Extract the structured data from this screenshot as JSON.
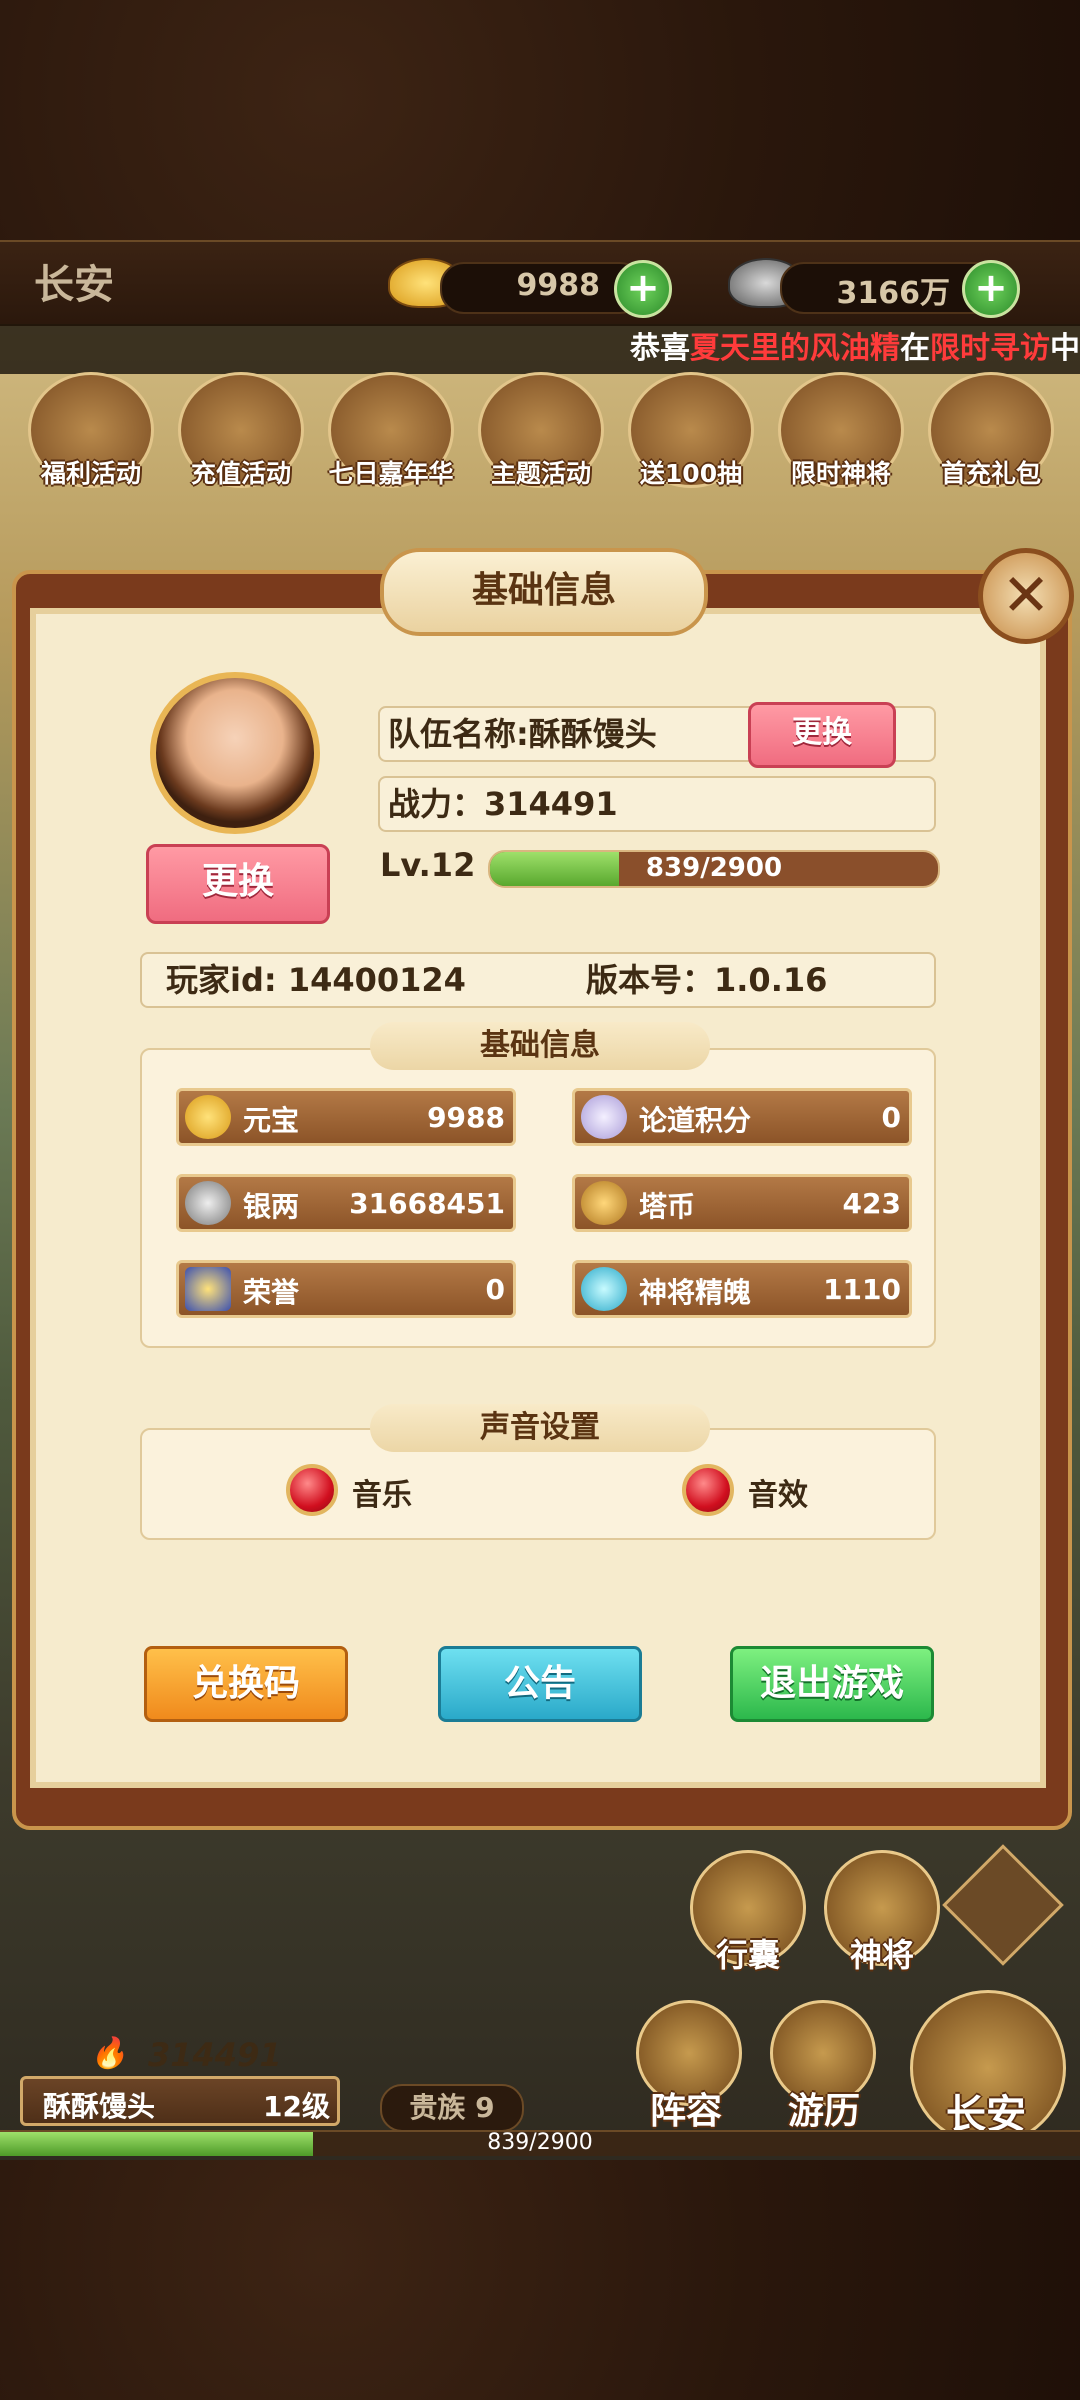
{
  "topbar": {
    "city": "长安",
    "gold": "9988",
    "silver": "3166万"
  },
  "marquee": {
    "p1": "恭喜",
    "p2": "夏天里的风油精",
    "p3": "在",
    "p4": "限时寻访",
    "p5": "中"
  },
  "activities": [
    "福利活动",
    "充值活动",
    "七日嘉年华",
    "主题活动",
    "送100抽",
    "限时神将",
    "首充礼包"
  ],
  "panel": {
    "title": "基础信息",
    "change_avatar": "更换",
    "team_name": "队伍名称:酥酥馒头",
    "change_name": "更换",
    "power": "战力：314491",
    "level": "Lv.12",
    "xp_text": "839/2900",
    "xp_fraction": 0.289,
    "player_id": "玩家id: 14400124",
    "version": "版本号：1.0.16",
    "basic_label": "基础信息",
    "resources": [
      {
        "name": "元宝",
        "value": "9988",
        "icon": "gold-ingot-icon"
      },
      {
        "name": "论道积分",
        "value": "0",
        "icon": "scroll-icon"
      },
      {
        "name": "银两",
        "value": "31668451",
        "icon": "silver-ingot-icon"
      },
      {
        "name": "塔币",
        "value": "423",
        "icon": "coin-icon"
      },
      {
        "name": "荣誉",
        "value": "0",
        "icon": "honor-badge-icon"
      },
      {
        "name": "神将精魄",
        "value": "1110",
        "icon": "spirit-gem-icon"
      }
    ],
    "sound_label": "声音设置",
    "music": "音乐",
    "sfx": "音效",
    "redeem": "兑换码",
    "notice": "公告",
    "exit": "退出游戏"
  },
  "hud": {
    "power": "314491",
    "name": "酥酥馒头",
    "level": "12级",
    "vip": "贵族 9",
    "xp": "839/2900",
    "bag": "行囊",
    "hero": "神将",
    "lineup": "阵容",
    "travel": "游历",
    "city": "长安"
  },
  "colors": {
    "accent_red": "#ff3b3b",
    "xp_green": "#59a82e",
    "panel_bg": "#f6ebcd"
  }
}
